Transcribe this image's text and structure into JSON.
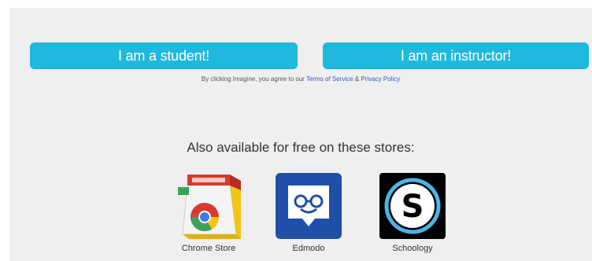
{
  "buttons": {
    "student": "I am a student!",
    "instructor": "I am an instructor!"
  },
  "terms": {
    "prefix": "By clicking Imagine, you agree to our",
    "tos": "Terms of Service",
    "amp": "&",
    "privacy": "Privacy Policy"
  },
  "stores": {
    "title": "Also available for free on these stores:",
    "items": [
      {
        "label": "Chrome Store",
        "icon": "chrome-store-icon"
      },
      {
        "label": "Edmodo",
        "icon": "edmodo-icon"
      },
      {
        "label": "Schoology",
        "icon": "schoology-icon"
      }
    ]
  },
  "colors": {
    "button": "#20b8dc",
    "panel": "#efefef",
    "link": "#3355cc",
    "edmodo": "#1f4fa8",
    "schoology_ring": "#4ab6e6"
  }
}
